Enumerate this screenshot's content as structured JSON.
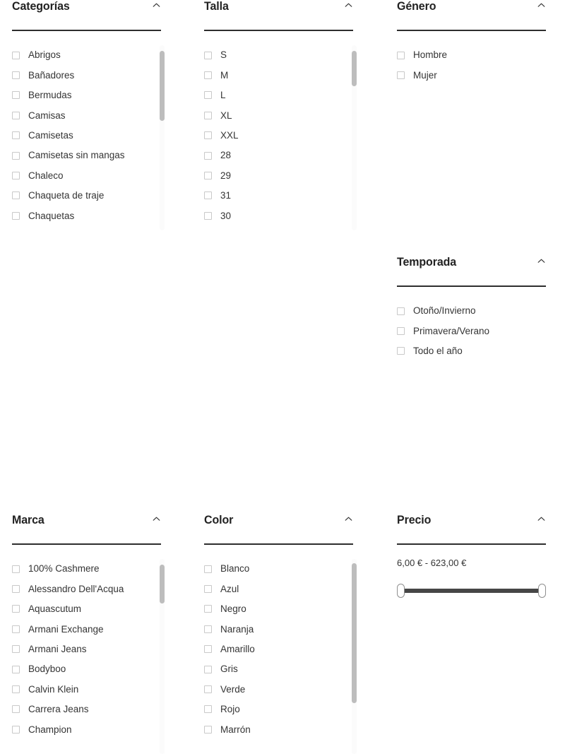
{
  "common": {
    "collapse_icon": "chevron-up-icon",
    "checkbox_icon": "checkbox-unchecked-icon"
  },
  "filters": {
    "categorias": {
      "title": "Categorías",
      "options": [
        "Abrigos",
        "Bañadores",
        "Bermudas",
        "Camisas",
        "Camisetas",
        "Camisetas sin mangas",
        "Chaleco",
        "Chaqueta de traje",
        "Chaquetas"
      ],
      "scroll": {
        "thumb_top_pct": 3,
        "thumb_height_pct": 38
      }
    },
    "talla": {
      "title": "Talla",
      "options": [
        "S",
        "M",
        "L",
        "XL",
        "XXL",
        "28",
        "29",
        "31",
        "30"
      ],
      "scroll": {
        "thumb_top_pct": 3,
        "thumb_height_pct": 19
      }
    },
    "genero": {
      "title": "Género",
      "options": [
        "Hombre",
        "Mujer"
      ]
    },
    "temporada": {
      "title": "Temporada",
      "options": [
        "Otoño/Invierno",
        "Primavera/Verano",
        "Todo el año"
      ]
    },
    "marca": {
      "title": "Marca",
      "options": [
        "100% Cashmere",
        "Alessandro Dell'Acqua",
        "Aquascutum",
        "Armani Exchange",
        "Armani Jeans",
        "Bodyboo",
        "Calvin Klein",
        "Carrera Jeans",
        "Champion"
      ],
      "scroll": {
        "thumb_top_pct": 3,
        "thumb_height_pct": 20
      }
    },
    "color": {
      "title": "Color",
      "options": [
        "Blanco",
        "Azul",
        "Negro",
        "Naranja",
        "Amarillo",
        "Gris",
        "Verde",
        "Rojo",
        "Marrón"
      ],
      "scroll": {
        "thumb_top_pct": 2,
        "thumb_height_pct": 72
      }
    },
    "precio": {
      "title": "Precio",
      "range_label": "6,00 € - 623,00 €",
      "min_value": "6,00 €",
      "max_value": "623,00 €",
      "slider_left_pct": 0,
      "slider_right_pct": 100
    }
  },
  "colors": {
    "rule": "#2e2e2e",
    "title": "#222222",
    "label": "#343434",
    "checkbox_border": "#c9c9c9",
    "scroll_thumb": "#bdbdbd",
    "scroll_track": "#fbfbfb",
    "slider_track": "#464646"
  }
}
